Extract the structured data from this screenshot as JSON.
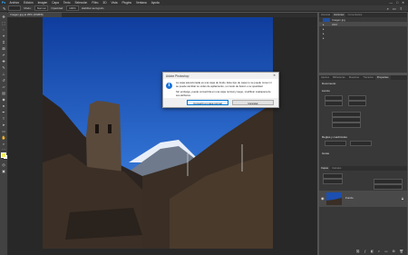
{
  "app": {
    "logo": "Ps"
  },
  "menu": [
    "Archivo",
    "Edición",
    "Imagen",
    "Capa",
    "Texto",
    "Selección",
    "Filtro",
    "3D",
    "Vista",
    "Plugins",
    "Ventana",
    "Ayuda"
  ],
  "window_controls": {
    "minimize": "—",
    "maximize": "□",
    "close": "✕"
  },
  "options_bar": {
    "mode_label": "Modo:",
    "mode_value": "Normal",
    "opacity_label": "Opacidad:",
    "opacity_value": "100%",
    "extra": "Habilitar aerógrafo"
  },
  "document": {
    "tab_label": "Imagen.jpg al 25% (RGB/8)"
  },
  "history_panel": {
    "tabs": [
      "Historial",
      "Acciones",
      "Comentarios"
    ],
    "active_tab": "Acciones",
    "snapshot": "Imagen.jpg",
    "items": [
      "Abrir",
      "",
      "",
      "",
      "",
      ""
    ]
  },
  "properties_panel": {
    "tabs": [
      "Ajustes",
      "Bibliotecas",
      "Muestras",
      "Trazados",
      "Properties"
    ],
    "active_tab": "Properties",
    "section_document": "Documento",
    "section_canvas": "Lienzo",
    "section_rulers": "Reglas y cuadrículas",
    "section_guides": "Guías"
  },
  "layers_panel": {
    "tabs": [
      "Capas",
      "Canales"
    ],
    "active_tab": "Capas",
    "layer_name": "Fondo"
  },
  "dialog": {
    "title": "Adobe Photoshop",
    "close": "✕",
    "message_line1": "La capa seleccionada es una capa de fondo. Este tipo de capa no se puede mover ni",
    "message_line2": "se puede cambiar su orden de apilamiento, su modo de fusión o su opacidad.",
    "message_line3": "Sin embargo, puede convertirla en una capa normal y luego, modificar cualquiera de",
    "message_line4": "sus atributos.",
    "convert_button": "Convertir en capa normal",
    "cancel_button": "Cancelar",
    "info_glyph": "i"
  },
  "colors": {
    "accent": "#0078d7",
    "sky": "#1b4fb6",
    "info": "#1a73d9"
  }
}
